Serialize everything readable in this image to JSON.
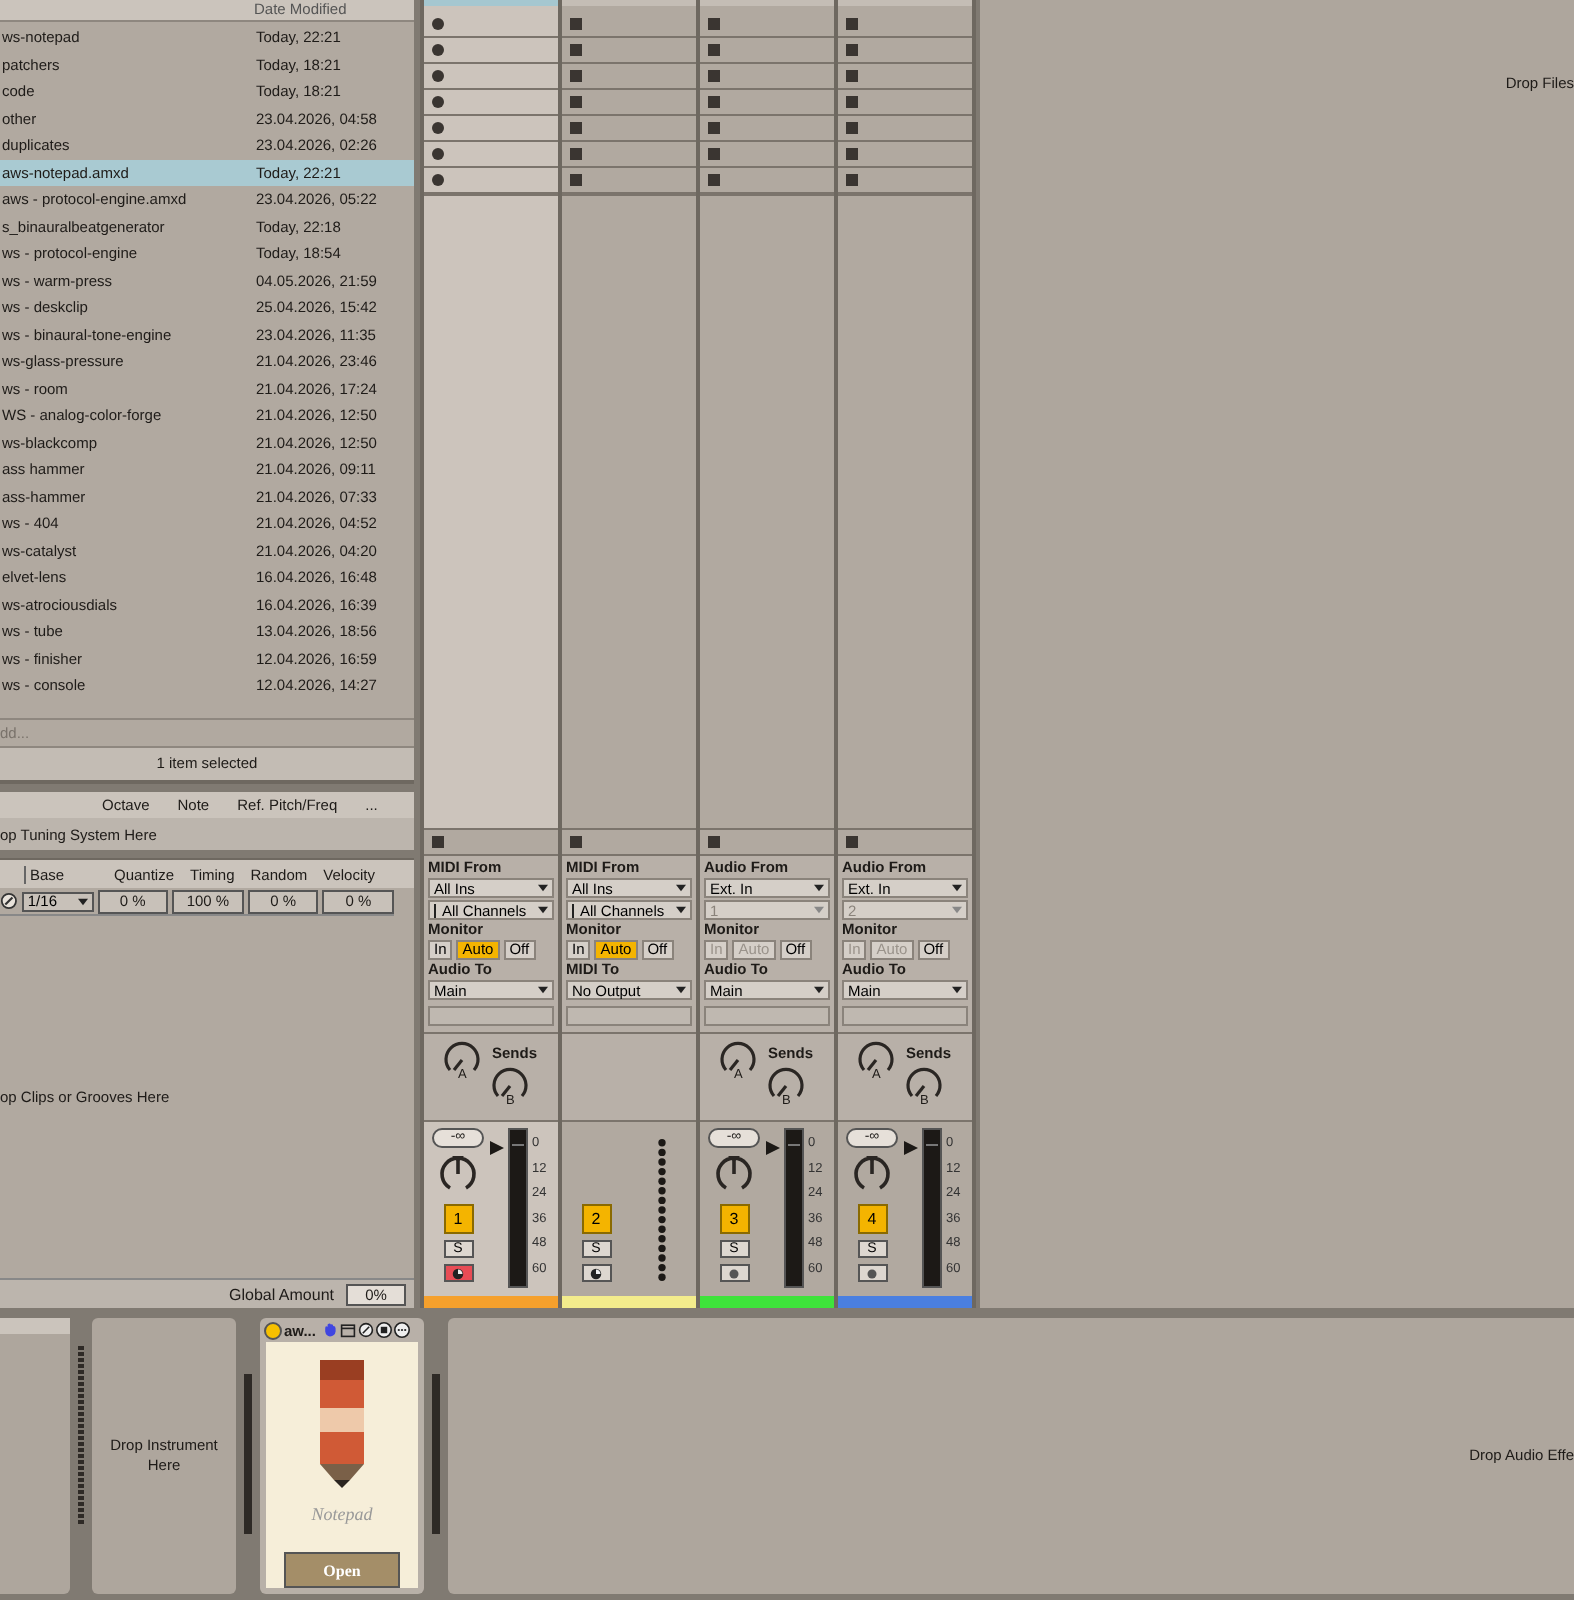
{
  "browser": {
    "date_header": "Date Modified",
    "files": [
      {
        "name": "ws-notepad",
        "date": "Today, 22:21",
        "selected": false
      },
      {
        "name": "patchers",
        "date": "Today, 18:21",
        "selected": false
      },
      {
        "name": "code",
        "date": "Today, 18:21",
        "selected": false
      },
      {
        "name": "other",
        "date": "23.04.2026, 04:58",
        "selected": false
      },
      {
        "name": "duplicates",
        "date": "23.04.2026, 02:26",
        "selected": false
      },
      {
        "name": "aws-notepad.amxd",
        "date": "Today, 22:21",
        "selected": true
      },
      {
        "name": "aws - protocol-engine.amxd",
        "date": "23.04.2026, 05:22",
        "selected": false
      },
      {
        "name": "s_binauralbeatgenerator",
        "date": "Today, 22:18",
        "selected": false
      },
      {
        "name": "ws - protocol-engine",
        "date": "Today, 18:54",
        "selected": false
      },
      {
        "name": "ws - warm-press",
        "date": "04.05.2026, 21:59",
        "selected": false
      },
      {
        "name": "ws - deskclip",
        "date": "25.04.2026, 15:42",
        "selected": false
      },
      {
        "name": "ws - binaural-tone-engine",
        "date": "23.04.2026, 11:35",
        "selected": false
      },
      {
        "name": "ws-glass-pressure",
        "date": "21.04.2026, 23:46",
        "selected": false
      },
      {
        "name": "ws - room",
        "date": "21.04.2026, 17:24",
        "selected": false
      },
      {
        "name": "WS - analog-color-forge",
        "date": "21.04.2026, 12:50",
        "selected": false
      },
      {
        "name": "ws-blackcomp",
        "date": "21.04.2026, 12:50",
        "selected": false
      },
      {
        "name": "ass hammer",
        "date": "21.04.2026, 09:11",
        "selected": false
      },
      {
        "name": "ass-hammer",
        "date": "21.04.2026, 07:33",
        "selected": false
      },
      {
        "name": "ws - 404",
        "date": "21.04.2026, 04:52",
        "selected": false
      },
      {
        "name": "ws-catalyst",
        "date": "21.04.2026, 04:20",
        "selected": false
      },
      {
        "name": "elvet-lens",
        "date": "16.04.2026, 16:48",
        "selected": false
      },
      {
        "name": "ws-atrociousdials",
        "date": "16.04.2026, 16:39",
        "selected": false
      },
      {
        "name": "ws - tube",
        "date": "13.04.2026, 18:56",
        "selected": false
      },
      {
        "name": "ws - finisher",
        "date": "12.04.2026, 16:59",
        "selected": false
      },
      {
        "name": "ws - console",
        "date": "12.04.2026, 14:27",
        "selected": false
      }
    ],
    "add_placeholder": "dd...",
    "status": "1 item selected"
  },
  "tuning": {
    "columns": [
      "Octave",
      "Note",
      "Ref. Pitch/Freq",
      "..."
    ],
    "drop_hint": "op Tuning System Here"
  },
  "groove": {
    "columns": [
      "Base",
      "Quantize",
      "Timing",
      "Random",
      "Velocity"
    ],
    "base": "1/16",
    "values": [
      "0 %",
      "100 %",
      "0 %",
      "0 %"
    ],
    "drop_hint": "op Clips or Grooves Here",
    "global_amount_label": "Global Amount",
    "global_amount": "0%"
  },
  "tracks": [
    {
      "kind": "midi",
      "selected": true,
      "color": "#f5a02c",
      "source_label": "MIDI From",
      "source": "All Ins",
      "channel": "All Channels",
      "monitor_label": "Monitor",
      "monitor": [
        {
          "label": "In",
          "selected": false,
          "disabled": false
        },
        {
          "label": "Auto",
          "selected": true,
          "disabled": false
        },
        {
          "label": "Off",
          "selected": false,
          "disabled": false
        }
      ],
      "output_label": "Audio To",
      "output": "Main",
      "sends": {
        "label": "Sends",
        "knobs": [
          "A",
          "B"
        ]
      },
      "volume": "-∞",
      "meter": true,
      "scale": [
        "0",
        "12",
        "24",
        "36",
        "48",
        "60"
      ],
      "number": "1",
      "solo": "S",
      "armed": true
    },
    {
      "kind": "midi",
      "selected": false,
      "color": "#f3ec8c",
      "source_label": "MIDI From",
      "source": "All Ins",
      "channel": "All Channels",
      "monitor_label": "Monitor",
      "monitor": [
        {
          "label": "In",
          "selected": false,
          "disabled": false
        },
        {
          "label": "Auto",
          "selected": true,
          "disabled": false
        },
        {
          "label": "Off",
          "selected": false,
          "disabled": false
        }
      ],
      "output_label": "MIDI To",
      "output": "No Output",
      "meter": false,
      "number": "2",
      "solo": "S",
      "armed": false
    },
    {
      "kind": "audio",
      "selected": false,
      "color": "#3ee33b",
      "source_label": "Audio From",
      "source": "Ext. In",
      "channel": "1",
      "monitor_label": "Monitor",
      "monitor": [
        {
          "label": "In",
          "selected": false,
          "disabled": true
        },
        {
          "label": "Auto",
          "selected": false,
          "disabled": true
        },
        {
          "label": "Off",
          "selected": false,
          "disabled": false
        }
      ],
      "output_label": "Audio To",
      "output": "Main",
      "sends": {
        "label": "Sends",
        "knobs": [
          "A",
          "B"
        ]
      },
      "volume": "-∞",
      "meter": true,
      "scale": [
        "0",
        "12",
        "24",
        "36",
        "48",
        "60"
      ],
      "number": "3",
      "solo": "S",
      "armed": false
    },
    {
      "kind": "audio",
      "selected": false,
      "color": "#4a7fe0",
      "source_label": "Audio From",
      "source": "Ext. In",
      "channel": "2",
      "monitor_label": "Monitor",
      "monitor": [
        {
          "label": "In",
          "selected": false,
          "disabled": true
        },
        {
          "label": "Auto",
          "selected": false,
          "disabled": true
        },
        {
          "label": "Off",
          "selected": false,
          "disabled": false
        }
      ],
      "output_label": "Audio To",
      "output": "Main",
      "sends": {
        "label": "Sends",
        "knobs": [
          "A",
          "B"
        ]
      },
      "volume": "-∞",
      "meter": true,
      "scale": [
        "0",
        "12",
        "24",
        "36",
        "48",
        "60"
      ],
      "number": "4",
      "solo": "S",
      "armed": false
    }
  ],
  "drop_files": "Drop Files",
  "device_chain": {
    "instrument_hint": "Drop Instrument Here",
    "device": {
      "title": "aw...",
      "on": true,
      "label": "Notepad",
      "button": "Open"
    },
    "effect_hint": "Drop Audio Effe"
  }
}
